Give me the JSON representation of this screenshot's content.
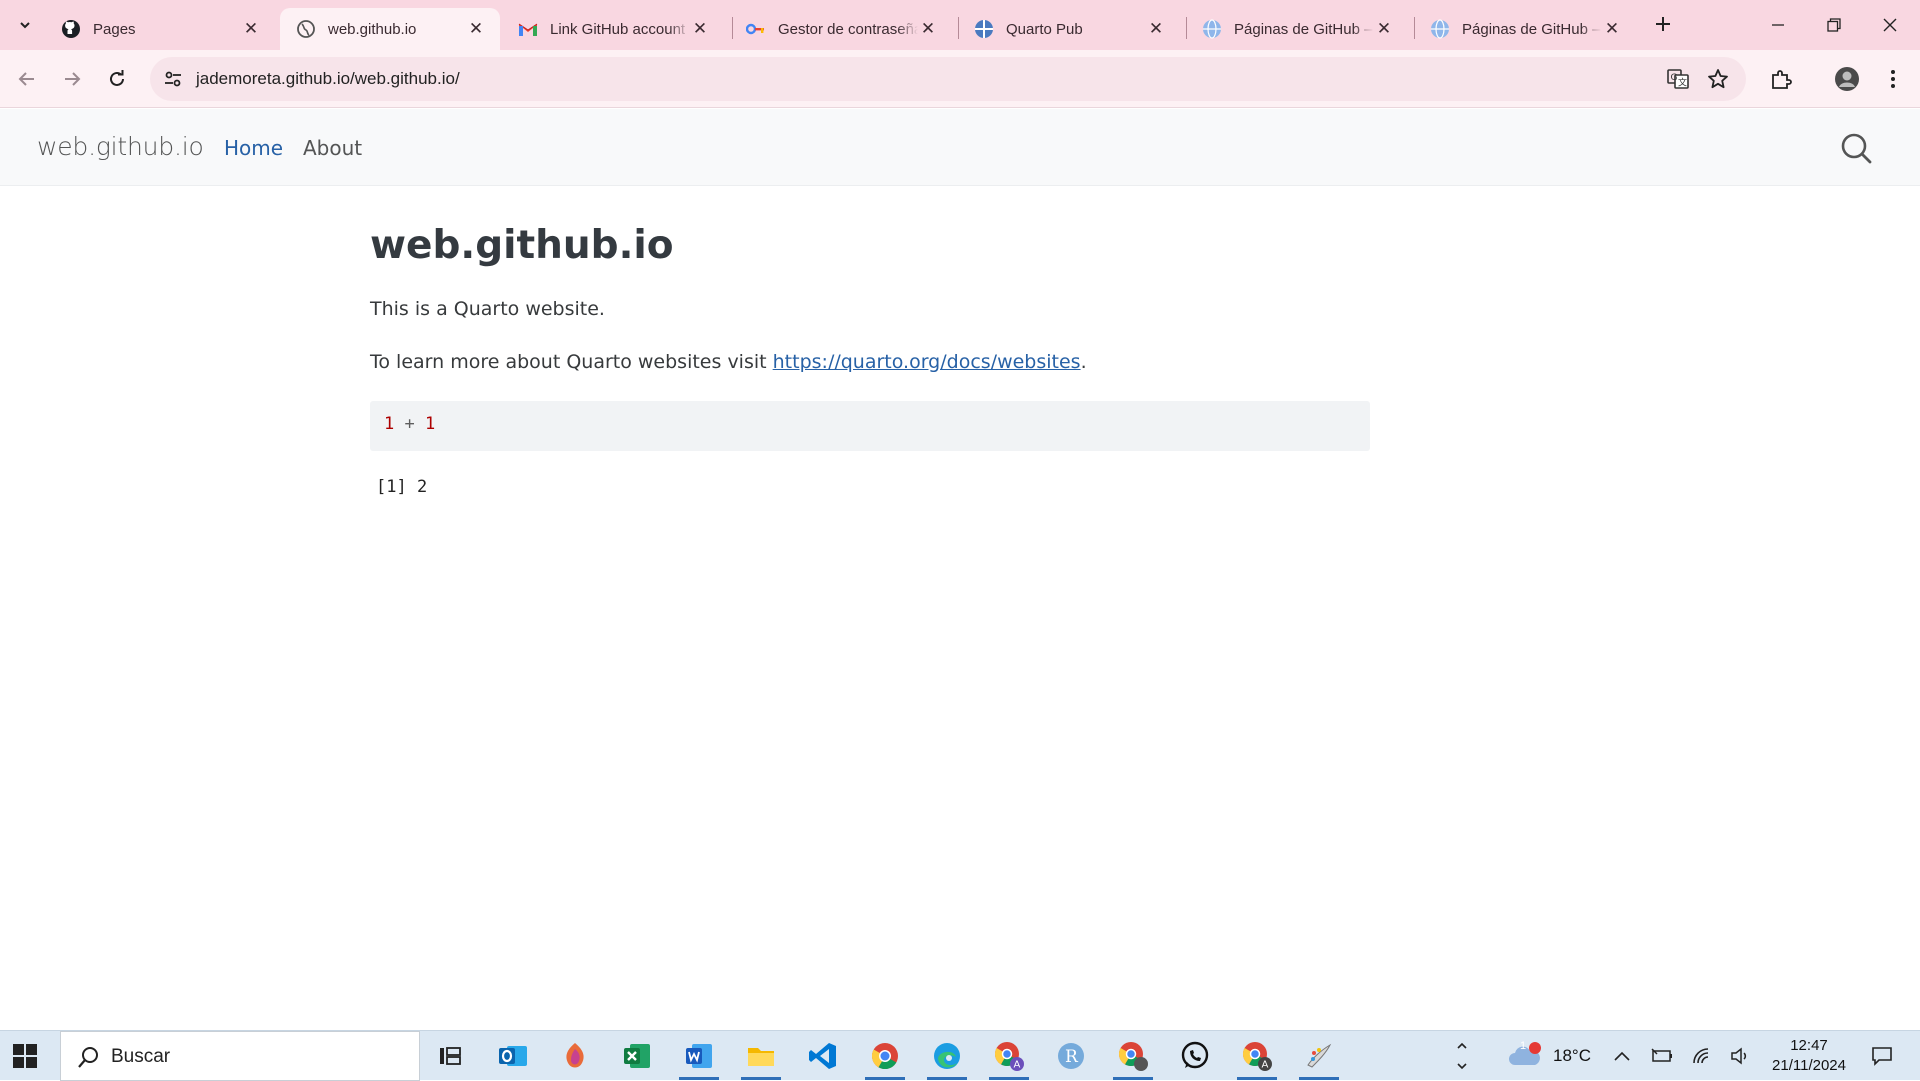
{
  "tabs": [
    {
      "title": "Pages",
      "icon": "github-icon",
      "active": false
    },
    {
      "title": "web.github.io",
      "icon": "globe-icon",
      "active": true
    },
    {
      "title": "Link GitHub account",
      "icon": "gmail-icon",
      "active": false
    },
    {
      "title": "Gestor de contraseñas",
      "icon": "password-manager-icon",
      "active": false
    },
    {
      "title": "Quarto Pub",
      "icon": "quarto-icon",
      "active": false
    },
    {
      "title": "Páginas de GitHub – ",
      "icon": "globe-icon",
      "active": false
    },
    {
      "title": "Páginas de GitHub – ",
      "icon": "globe-icon",
      "active": false
    }
  ],
  "address": {
    "url": "jademoreta.github.io/web.github.io/"
  },
  "site": {
    "brand": "web.github.io",
    "nav": {
      "home": "Home",
      "about": "About"
    }
  },
  "page": {
    "title": "web.github.io",
    "intro": "This is a Quarto website.",
    "learn_prefix": "To learn more about Quarto websites visit ",
    "learn_link": "https://quarto.org/docs/websites",
    "learn_suffix": ".",
    "code": {
      "a": "1",
      "op": " + ",
      "b": "1"
    },
    "output": "[1] 2"
  },
  "taskbar": {
    "search_placeholder": "Buscar",
    "apps": [
      "task-view",
      "outlook",
      "copilot",
      "excel",
      "word",
      "file-explorer",
      "vscode",
      "chrome",
      "edge",
      "chrome-profile",
      "r-project",
      "chrome-profile",
      "whatsapp",
      "chrome-profile",
      "paint"
    ],
    "weather": {
      "temp": "18°C",
      "badge": "1"
    },
    "time": "12:47",
    "date": "21/11/2024"
  },
  "colors": {
    "accent": "#2761a6",
    "tabstrip": "#f9d7e1",
    "taskbar": "#dce8f3"
  }
}
